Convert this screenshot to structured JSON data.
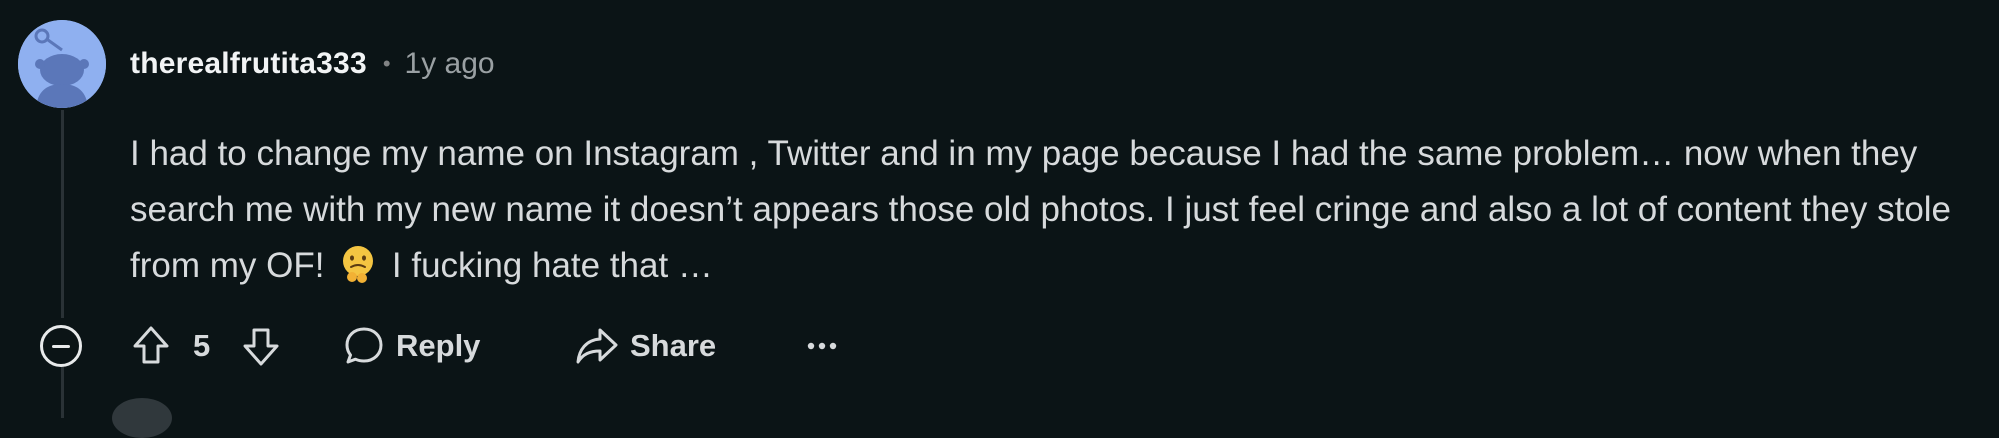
{
  "comment": {
    "author": "therealfrutita333",
    "separator": "•",
    "timestamp": "1y ago",
    "body_part1": "I had to change my name on Instagram , Twitter and in my page because I had the same problem… now when they search me with my new name it doesn’t appears those old photos. I just feel cringe and also a lot of content they stole from my OF!",
    "emoji_icon": "face-holding-back-tears-emoji",
    "body_part2": "I fucking hate that …",
    "avatar_icon": "snoo-avatar-icon",
    "avatar_color": "#8fb0f0"
  },
  "actions": {
    "collapse_icon": "collapse-minus-icon",
    "upvote_icon": "upvote-arrow-icon",
    "score": "5",
    "downvote_icon": "downvote-arrow-icon",
    "reply_label": "Reply",
    "reply_icon": "comment-bubble-icon",
    "share_label": "Share",
    "share_icon": "share-arrow-icon",
    "more_icon": "more-options-icon"
  },
  "colors": {
    "background": "#0b1416",
    "text": "#d7dadc",
    "muted": "#9aa0a3",
    "thread_line": "#2a3236"
  }
}
